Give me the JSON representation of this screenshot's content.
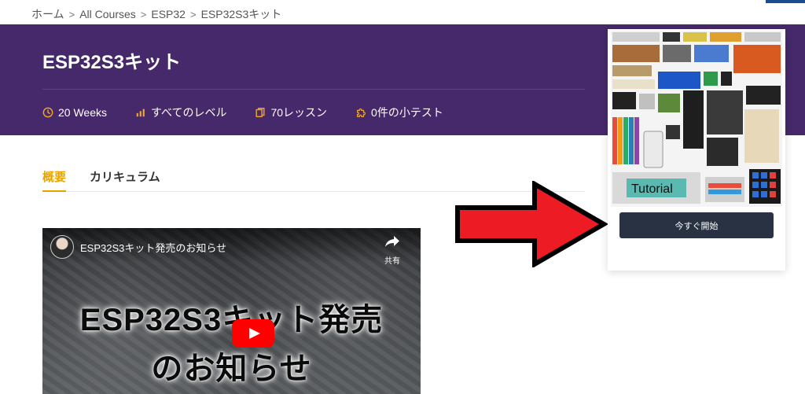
{
  "breadcrumb": {
    "items": [
      "ホーム",
      "All Courses",
      "ESP32",
      "ESP32S3キット"
    ],
    "separator": ">"
  },
  "course": {
    "title": "ESP32S3キット",
    "meta": {
      "duration": "20 Weeks",
      "level": "すべてのレベル",
      "lessons": "70レッスン",
      "quizzes": "0件の小テスト"
    }
  },
  "tabs": [
    {
      "label": "概要",
      "active": true
    },
    {
      "label": "カリキュラム",
      "active": false
    }
  ],
  "video": {
    "title": "ESP32S3キット発売のお知らせ",
    "share_label": "共有",
    "overlay_line1": "ESP32S3キット発売",
    "overlay_line2": "のお知らせ"
  },
  "card": {
    "image_label": "Tutorial",
    "start_button": "今すぐ開始"
  },
  "colors": {
    "hero_bg": "#45296a",
    "accent": "#e8a300",
    "button_bg": "#293242",
    "arrow_red": "#ed1c24"
  },
  "icons": {
    "duration": "clock-icon",
    "level": "bar-chart-icon",
    "lessons": "copy-icon",
    "quizzes": "puzzle-icon"
  }
}
